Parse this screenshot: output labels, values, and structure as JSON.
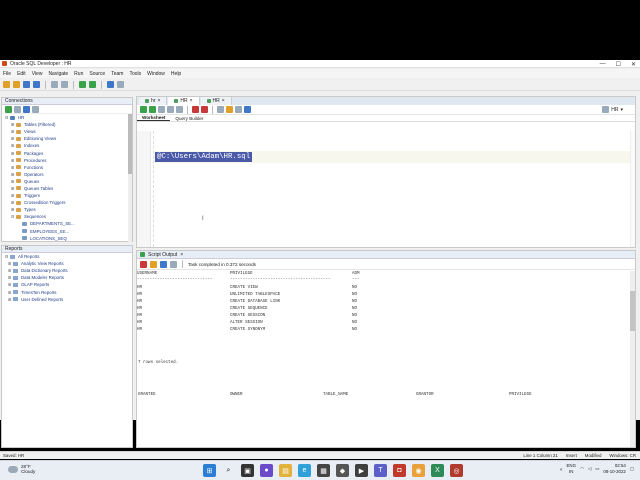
{
  "window": {
    "title": "Oracle SQL Developer : HR",
    "controls": [
      "—",
      "☐",
      "✕"
    ]
  },
  "menu": [
    "File",
    "Edit",
    "View",
    "Navigate",
    "Run",
    "Source",
    "Team",
    "Tools",
    "Window",
    "Help"
  ],
  "connections": {
    "title": "Connections",
    "tree": [
      {
        "label": "HR",
        "level": 0,
        "exp": "⊟",
        "type": "db"
      },
      {
        "label": "Tables (Filtered)",
        "level": 1,
        "exp": "⊞",
        "type": "folder"
      },
      {
        "label": "Views",
        "level": 1,
        "exp": "⊞",
        "type": "folder"
      },
      {
        "label": "Editioning Views",
        "level": 1,
        "exp": "⊞",
        "type": "folder"
      },
      {
        "label": "Indexes",
        "level": 1,
        "exp": "⊞",
        "type": "folder"
      },
      {
        "label": "Packages",
        "level": 1,
        "exp": "⊞",
        "type": "folder"
      },
      {
        "label": "Procedures",
        "level": 1,
        "exp": "⊞",
        "type": "folder"
      },
      {
        "label": "Functions",
        "level": 1,
        "exp": "⊞",
        "type": "folder"
      },
      {
        "label": "Operators",
        "level": 1,
        "exp": "⊞",
        "type": "folder"
      },
      {
        "label": "Queues",
        "level": 1,
        "exp": "⊞",
        "type": "folder"
      },
      {
        "label": "Queues Tables",
        "level": 1,
        "exp": "⊞",
        "type": "folder"
      },
      {
        "label": "Triggers",
        "level": 1,
        "exp": "⊞",
        "type": "folder"
      },
      {
        "label": "Crossedition Triggers",
        "level": 1,
        "exp": "⊞",
        "type": "folder"
      },
      {
        "label": "Types",
        "level": 1,
        "exp": "⊞",
        "type": "folder"
      },
      {
        "label": "Sequences",
        "level": 1,
        "exp": "⊟",
        "type": "folder"
      },
      {
        "label": "DEPARTMENTS_SE...",
        "level": 2,
        "exp": "",
        "type": "seq"
      },
      {
        "label": "EMPLOYEES_SE...",
        "level": 2,
        "exp": "",
        "type": "seq"
      },
      {
        "label": "LOCATIONS_SEQ",
        "level": 2,
        "exp": "",
        "type": "seq"
      }
    ]
  },
  "reports": {
    "title": "Reports",
    "items": [
      {
        "label": "All Reports",
        "exp": "⊟"
      },
      {
        "label": "Analytic View Reports",
        "exp": "⊞"
      },
      {
        "label": "Data Dictionary Reports",
        "exp": "⊞"
      },
      {
        "label": "Data Modeler Reports",
        "exp": "⊞"
      },
      {
        "label": "OLAP Reports",
        "exp": "⊞"
      },
      {
        "label": "TimesTen Reports",
        "exp": "⊞"
      },
      {
        "label": "User Defined Reports",
        "exp": "⊞"
      }
    ]
  },
  "editor": {
    "tabs": [
      {
        "label": "hr",
        "active": false
      },
      {
        "label": "HR",
        "active": true
      },
      {
        "label": "HR",
        "active": false
      }
    ],
    "connection_label": "HR",
    "subtabs": [
      "Worksheet",
      "Query Builder"
    ],
    "sql_text": "@C:\\Users\\Adam\\HR.sql"
  },
  "output": {
    "title": "Script Output",
    "status": "Task completed in 0.372 seconds",
    "columns": [
      "USERNAME",
      "PRIVILEGE",
      "ADM"
    ],
    "dashes": [
      "------------------------------",
      "----------------------------------------",
      "---"
    ],
    "rows": [
      [
        "HR",
        "CREATE VIEW",
        "NO"
      ],
      [
        "HR",
        "UNLIMITED TABLESPACE",
        "NO"
      ],
      [
        "HR",
        "CREATE DATABASE LINK",
        "NO"
      ],
      [
        "HR",
        "CREATE SEQUENCE",
        "NO"
      ],
      [
        "HR",
        "CREATE SESSION",
        "NO"
      ],
      [
        "HR",
        "ALTER SESSION",
        "NO"
      ],
      [
        "HR",
        "CREATE SYNONYM",
        "NO"
      ]
    ],
    "rows_selected": "7 rows selected.",
    "next_columns": [
      "GRANTEE",
      "OWNER",
      "TABLE_NAME",
      "GRANTOR",
      "PRIVILEGE"
    ]
  },
  "statusbar": {
    "left": "Saved: HR",
    "position": "Line 1 Column 21",
    "mode": "Insert",
    "state": "Modified",
    "line_end": "Windows: CR"
  },
  "taskbar": {
    "weather_temp": "28°F",
    "weather_desc": "Cloudy",
    "lang": "ENG",
    "region": "IN",
    "time": "02:54",
    "date": "08-10-2022"
  }
}
